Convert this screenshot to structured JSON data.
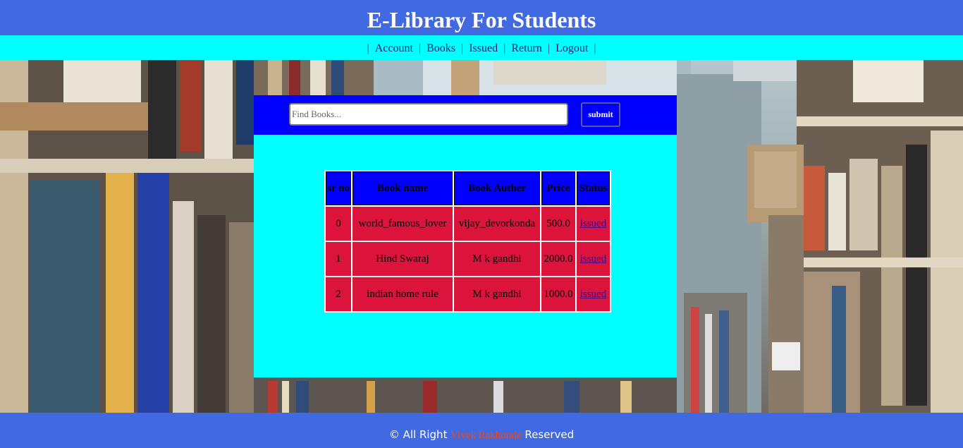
{
  "header": {
    "title": "E-Library For Students"
  },
  "nav": {
    "separator": "|",
    "items": [
      {
        "label": "Account"
      },
      {
        "label": "Books"
      },
      {
        "label": "Issued"
      },
      {
        "label": "Return"
      },
      {
        "label": "Logout"
      }
    ]
  },
  "search": {
    "placeholder": "Find Books...",
    "value": "",
    "submit_label": "submit"
  },
  "table": {
    "headers": [
      "sr no",
      "Book name",
      "Book Auther",
      "Price",
      "Status"
    ],
    "rows": [
      {
        "sr": "0",
        "name": "world_famous_lover",
        "author": "vijay_devorkonda",
        "price": "500.0",
        "status": "issued"
      },
      {
        "sr": "1",
        "name": "Hind Swaraj",
        "author": "M k gandhi",
        "price": "2000.0",
        "status": "issued"
      },
      {
        "sr": "2",
        "name": "indian home rule",
        "author": "M k gandhi",
        "price": "1000.0",
        "status": "issued"
      }
    ]
  },
  "footer": {
    "prefix": "© All Right",
    "author": "Vivek Rakhonde",
    "suffix": "Reserved"
  },
  "colors": {
    "header_bg": "#4169e1",
    "nav_bg": "#00ffff",
    "panel_bg": "#00ffff",
    "searchbar_bg": "#0000ff",
    "table_header_bg": "#0000ff",
    "table_cell_bg": "#dc143c",
    "footer_author": "#ff4500"
  }
}
